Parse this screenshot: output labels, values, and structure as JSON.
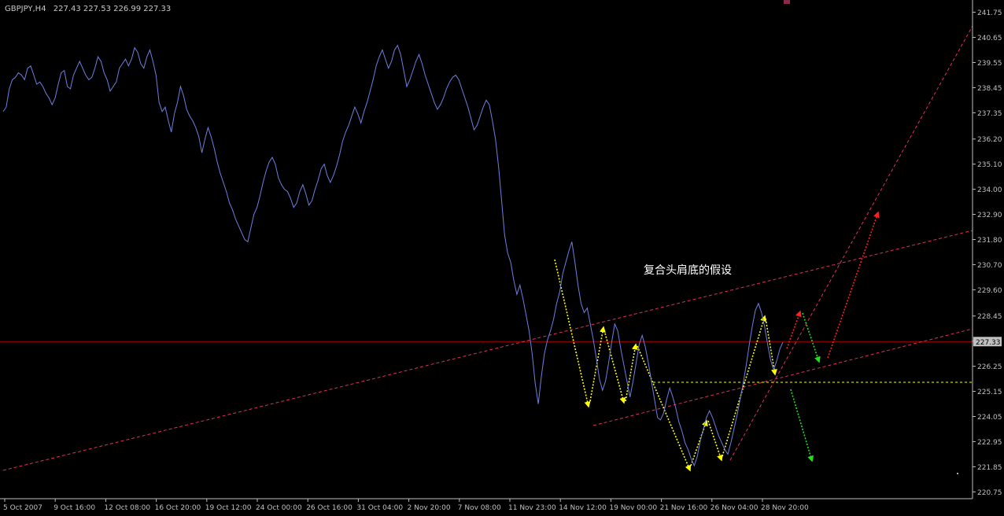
{
  "header": {
    "symbol": "GBPJPY,H4",
    "quote": "227.43 227.53 226.99 227.33"
  },
  "annotation": "复合头肩底的假设",
  "colors": {
    "background": "#000000",
    "price_line": "#6e7fe0",
    "axis": "#c0c0c0",
    "trend": "#e0305a",
    "current_price": "#b00000",
    "yellow": "#ffff00",
    "red": "#ff2020",
    "green": "#20e020",
    "price_box": "#c0c0c0"
  },
  "chart_data": {
    "type": "line",
    "title": "",
    "xlabel": "",
    "ylabel": "",
    "ylim": [
      220.45,
      242.15
    ],
    "yticks": [
      "241.75",
      "240.65",
      "239.55",
      "238.45",
      "237.35",
      "236.20",
      "235.10",
      "234.00",
      "232.90",
      "231.80",
      "230.70",
      "229.60",
      "228.45",
      "227.35",
      "226.25",
      "225.15",
      "224.05",
      "222.95",
      "221.85",
      "220.75"
    ],
    "xticks": [
      "5 Oct 2007",
      "9 Oct 16:00",
      "12 Oct 08:00",
      "16 Oct 20:00",
      "19 Oct 12:00",
      "24 Oct 00:00",
      "26 Oct 16:00",
      "31 Oct 04:00",
      "2 Nov 20:00",
      "7 Nov 08:00",
      "11 Nov 23:00",
      "14 Nov 12:00",
      "19 Nov 00:00",
      "21 Nov 16:00",
      "26 Nov 04:00",
      "28 Nov 20:00"
    ],
    "current_price": 227.33,
    "current_price_label": "227.33",
    "series": [
      {
        "values": [
          237.4,
          237.6,
          238.4,
          238.8,
          238.9,
          239.1,
          239.0,
          238.8,
          239.3,
          239.4,
          239.0,
          238.6,
          238.7,
          238.5,
          238.2,
          238.0,
          237.7,
          238.0,
          238.6,
          239.1,
          239.2,
          238.5,
          238.4,
          239.0,
          239.3,
          239.6,
          239.3,
          239.0,
          238.8,
          238.9,
          239.3,
          239.8,
          239.6,
          239.1,
          238.8,
          238.3,
          238.5,
          238.7,
          239.3,
          239.5,
          239.7,
          239.4,
          239.7,
          240.2,
          240.0,
          239.5,
          239.3,
          239.8,
          240.1,
          239.6,
          239.0,
          237.8,
          237.4,
          237.6,
          237.0,
          236.5,
          237.3,
          237.8,
          238.5,
          238.1,
          237.5,
          237.2,
          237.0,
          236.7,
          236.3,
          235.6,
          236.2,
          236.7,
          236.3,
          235.8,
          235.2,
          234.7,
          234.3,
          233.9,
          233.4,
          233.1,
          232.7,
          232.4,
          232.1,
          231.8,
          231.7,
          232.3,
          232.9,
          233.2,
          233.7,
          234.3,
          234.8,
          235.2,
          235.4,
          235.1,
          234.5,
          234.2,
          234.0,
          233.9,
          233.6,
          233.2,
          233.4,
          233.9,
          234.2,
          233.8,
          233.3,
          233.5,
          234.0,
          234.4,
          234.9,
          235.1,
          234.6,
          234.3,
          234.6,
          235.0,
          235.5,
          236.1,
          236.5,
          236.8,
          237.2,
          237.6,
          237.3,
          236.9,
          237.4,
          237.8,
          238.3,
          238.8,
          239.4,
          239.8,
          240.1,
          239.7,
          239.3,
          239.6,
          240.1,
          240.3,
          239.9,
          239.2,
          238.5,
          238.8,
          239.2,
          239.6,
          239.9,
          239.5,
          239.0,
          238.6,
          238.2,
          237.8,
          237.5,
          237.7,
          238.0,
          238.4,
          238.7,
          238.9,
          239.0,
          238.8,
          238.4,
          238.0,
          237.6,
          237.1,
          236.6,
          236.8,
          237.2,
          237.6,
          237.9,
          237.7,
          237.0,
          236.2,
          235.0,
          233.5,
          232.0,
          231.2,
          230.8,
          230.0,
          229.4,
          229.8,
          229.2,
          228.5,
          227.8,
          226.8,
          225.5,
          224.6,
          225.8,
          226.8,
          227.4,
          227.8,
          228.3,
          229.0,
          229.5,
          230.3,
          230.8,
          231.3,
          231.7,
          230.8,
          229.8,
          229.0,
          228.6,
          228.8,
          228.1,
          227.4,
          226.6,
          225.7,
          225.2,
          225.6,
          226.4,
          227.3,
          228.1,
          227.8,
          227.0,
          226.3,
          225.6,
          224.9,
          225.6,
          226.4,
          227.2,
          227.6,
          227.1,
          226.4,
          225.6,
          224.8,
          224.0,
          223.9,
          224.2,
          224.8,
          225.3,
          224.9,
          224.4,
          223.8,
          223.4,
          222.9,
          222.6,
          222.2,
          221.9,
          222.3,
          223.0,
          223.5,
          224.0,
          224.3,
          224.0,
          223.6,
          223.2,
          222.9,
          222.6,
          222.4,
          222.9,
          223.5,
          224.1,
          224.8,
          225.5,
          226.3,
          227.2,
          228.0,
          228.7,
          229.0,
          228.6,
          228.0,
          227.2,
          226.5,
          226.1,
          226.5,
          227.0,
          227.3
        ]
      }
    ]
  }
}
